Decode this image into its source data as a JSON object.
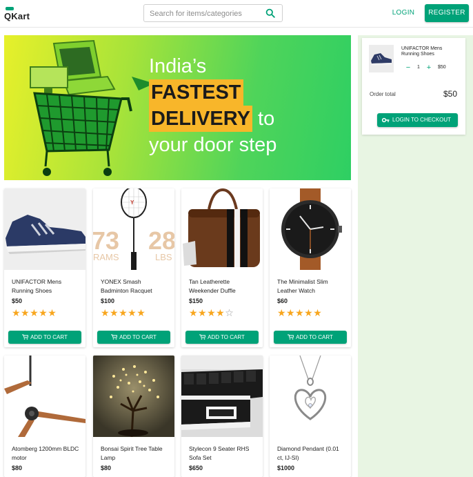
{
  "header": {
    "logo_text": "QKart",
    "search_placeholder": "Search for items/categories",
    "login_label": "LOGIN",
    "register_label": "REGISTER"
  },
  "banner": {
    "line1": "India’s",
    "highlight1": "FASTEST",
    "highlight2": "DELIVERY",
    "line_to": "to",
    "line_last": "your door step"
  },
  "cart": {
    "item_name": "UNIFACTOR Mens Running Shoes",
    "qty_minus": "−",
    "qty": "1",
    "qty_plus": "+",
    "item_price": "$50",
    "order_total_label": "Order total",
    "order_total": "$50",
    "checkout_label": "LOGIN TO CHECKOUT"
  },
  "products": [
    {
      "name": "UNIFACTOR Mens Running Shoes",
      "price": "$50",
      "rating": 5,
      "cta": "ADD TO CART"
    },
    {
      "name": "YONEX Smash Badminton Racquet",
      "price": "$100",
      "rating": 5,
      "cta": "ADD TO CART"
    },
    {
      "name": "Tan Leatherette Weekender Duffle",
      "price": "$150",
      "rating": 4,
      "cta": "ADD TO CART"
    },
    {
      "name": "The Minimalist Slim Leather Watch",
      "price": "$60",
      "rating": 5,
      "cta": "ADD TO CART"
    },
    {
      "name": "Atomberg 1200mm BLDC motor",
      "price": "$80",
      "rating": 0,
      "cta": "ADD TO CART"
    },
    {
      "name": "Bonsai Spirit Tree Table Lamp",
      "price": "$80",
      "rating": 0,
      "cta": "ADD TO CART"
    },
    {
      "name": "Stylecon 9 Seater RHS Sofa Set",
      "price": "$650",
      "rating": 0,
      "cta": "ADD TO CART"
    },
    {
      "name": "Diamond Pendant (0.01 ct, IJ-SI)",
      "price": "$1000",
      "rating": 0,
      "cta": "ADD TO CART"
    }
  ],
  "racquet_print": {
    "left_num": "73",
    "left_word": "RAMS",
    "right_num": "28",
    "right_word": "LBS"
  },
  "colors": {
    "accent": "#00a278",
    "star": "#f8a61e",
    "cart_bg": "#e8f5e3",
    "highlight": "#f8b62a"
  }
}
